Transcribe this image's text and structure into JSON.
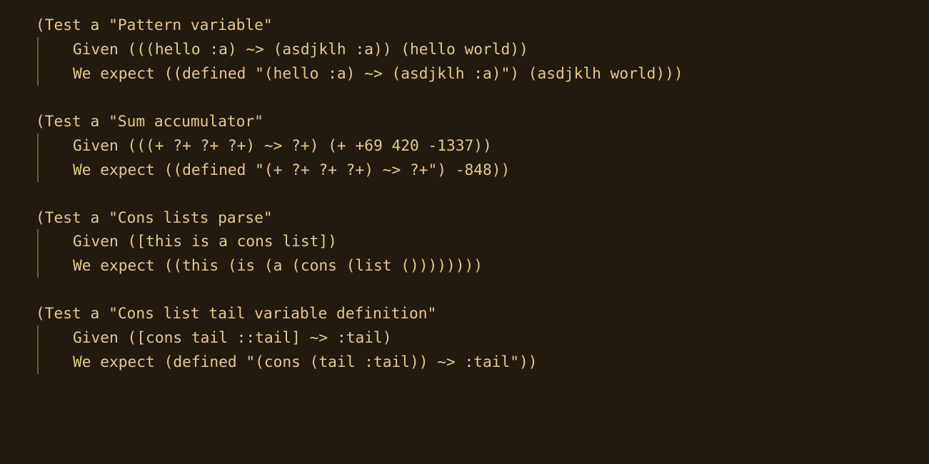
{
  "tests": [
    {
      "head_prefix": "(Test a ",
      "head_title": "\"Pattern variable\"",
      "given_label": "Given ",
      "given_body": "(((hello :a) ~> (asdjklh :a)) (hello world))",
      "expect_label": "We expect ",
      "expect_body": "((defined \"(hello :a) ~> (asdjklh :a)\") (asdjklh world)))"
    },
    {
      "head_prefix": "(Test a ",
      "head_title": "\"Sum accumulator\"",
      "given_label": "Given ",
      "given_body": "(((+ ?+ ?+ ?+) ~> ?+) (+ +69 420 -1337))",
      "expect_label": "We expect ",
      "expect_body": "((defined \"(+ ?+ ?+ ?+) ~> ?+\") -848))"
    },
    {
      "head_prefix": "(Test a ",
      "head_title": "\"Cons lists parse\"",
      "given_label": "Given ",
      "given_body": "([this is a cons list])",
      "expect_label": "We expect ",
      "expect_body": "((this (is (a (cons (list ())))))))"
    },
    {
      "head_prefix": "(Test a ",
      "head_title": "\"Cons list tail variable definition\"",
      "given_label": "Given ",
      "given_body": "([cons tail ::tail] ~> :tail)",
      "expect_label": "We expect ",
      "expect_body": "(defined \"(cons (tail :tail)) ~> :tail\"))"
    }
  ]
}
